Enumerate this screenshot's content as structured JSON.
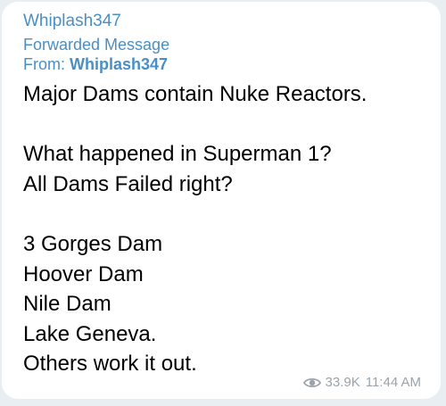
{
  "message": {
    "sender": "Whiplash347",
    "forwarded_label": "Forwarded Message",
    "from_prefix": "From: ",
    "from_name": "Whiplash347",
    "lines": [
      "Major Dams contain Nuke Reactors.",
      "",
      "What happened in Superman 1?",
      "All Dams Failed right?",
      "",
      "3 Gorges Dam",
      "Hoover Dam",
      "Nile Dam",
      "Lake Geneva.",
      "Others work it out."
    ],
    "views": "33.9K",
    "time": "11:44 AM",
    "views_icon": "eye-icon"
  },
  "colors": {
    "accent": "#4a8fc4",
    "meta": "#9aa3ab",
    "bubble": "#ffffff",
    "text": "#000000"
  }
}
